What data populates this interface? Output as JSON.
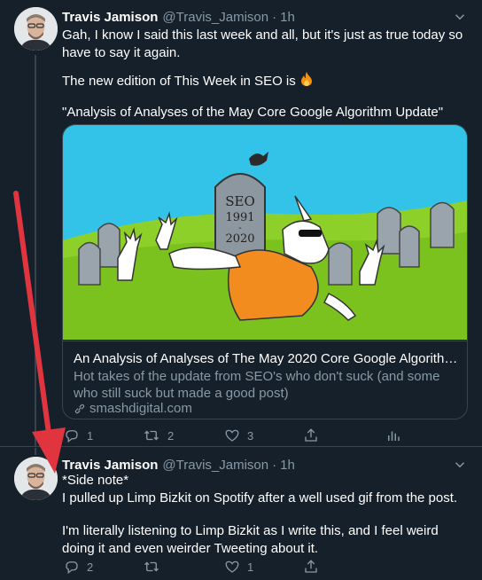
{
  "tweets": [
    {
      "name": "Travis Jamison",
      "handle": "@Travis_Jamison",
      "dot": "·",
      "time": "1h",
      "paragraphs": [
        "Gah, I know I said this last week and all, but it's just as true today so have to say it again.",
        "The new edition of This Week in SEO is",
        "\"Analysis of Analyses of the May Core Google Algorithm Update\""
      ],
      "emoji": "fire-icon",
      "card": {
        "image_text": [
          "SEO",
          "1991",
          "-",
          "2020"
        ],
        "title": "An Analysis of Analyses of The May 2020 Core Google Algorithm Up...",
        "description": "Hot takes of the update from SEO's who don't suck (and some who still suck but made a good post)",
        "domain": "smashdigital.com"
      },
      "actions": {
        "replies": "1",
        "retweets": "2",
        "likes": "3"
      }
    },
    {
      "name": "Travis Jamison",
      "handle": "@Travis_Jamison",
      "dot": "·",
      "time": "1h",
      "paragraphs": [
        "*Side note*",
        "I pulled up Limp Bizkit on Spotify after a well used gif from the post.",
        "I'm literally listening to Limp Bizkit as I write this, and I feel weird doing it and even weirder Tweeting about it."
      ],
      "actions": {
        "replies": "2",
        "retweets": "",
        "likes": "1"
      }
    }
  ],
  "colors": {
    "background": "#15202b",
    "border": "#38444d",
    "muted": "#8899a6",
    "arrow": "#e0353e"
  }
}
